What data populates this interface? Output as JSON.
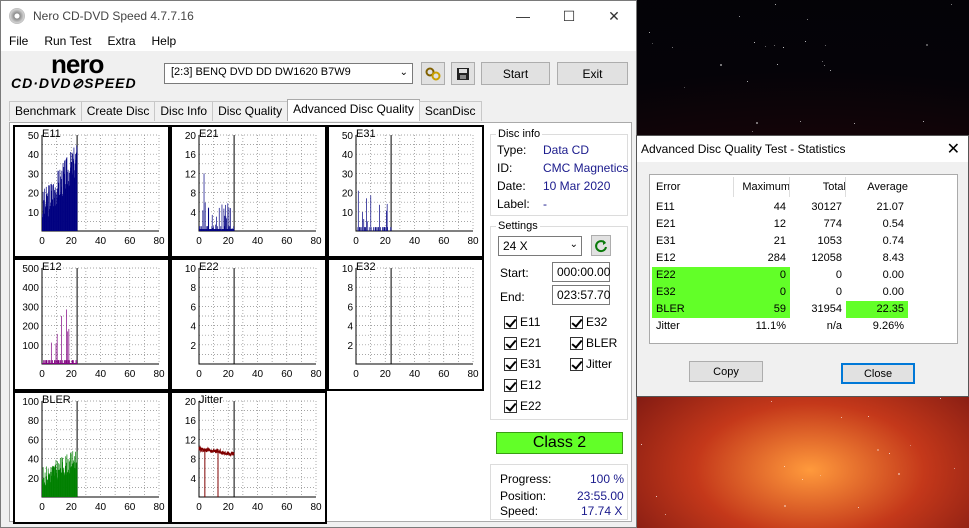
{
  "window": {
    "title": "Nero CD-DVD Speed 4.7.7.16",
    "minimize": "—",
    "maximize": "☐",
    "close": "✕"
  },
  "menu": [
    "File",
    "Run Test",
    "Extra",
    "Help"
  ],
  "logo": {
    "line1": "nero",
    "line2": "CD·DVD⊘SPEED"
  },
  "toolbar": {
    "drive": "[2:3]   BENQ DVD DD DW1620 B7W9",
    "drive_arrow": "⌄",
    "start_label": "Start",
    "exit_label": "Exit"
  },
  "tabs": [
    "Benchmark",
    "Create Disc",
    "Disc Info",
    "Disc Quality",
    "Advanced Disc Quality",
    "ScanDisc"
  ],
  "active_tab": 4,
  "charts": [
    {
      "name": "E11",
      "yticks": [
        "50",
        "40",
        "30",
        "20",
        "10"
      ],
      "xticks": [
        "0",
        "20",
        "40",
        "60",
        "80"
      ],
      "ymax": 50,
      "color": "#000080",
      "profile": "e11"
    },
    {
      "name": "E21",
      "yticks": [
        "20",
        "16",
        "12",
        "8",
        "4"
      ],
      "xticks": [
        "0",
        "20",
        "40",
        "60",
        "80"
      ],
      "ymax": 20,
      "color": "#000080",
      "profile": "e21"
    },
    {
      "name": "E31",
      "yticks": [
        "50",
        "40",
        "30",
        "20",
        "10"
      ],
      "xticks": [
        "0",
        "20",
        "40",
        "60",
        "80"
      ],
      "ymax": 50,
      "color": "#000080",
      "profile": "e31"
    },
    {
      "name": "E12",
      "yticks": [
        "500",
        "400",
        "300",
        "200",
        "100"
      ],
      "xticks": [
        "0",
        "20",
        "40",
        "60",
        "80"
      ],
      "ymax": 500,
      "color": "#800080",
      "profile": "e12"
    },
    {
      "name": "E22",
      "yticks": [
        "10",
        "8",
        "6",
        "4",
        "2"
      ],
      "xticks": [
        "0",
        "20",
        "40",
        "60",
        "80"
      ],
      "ymax": 10,
      "color": "#800080",
      "profile": "none"
    },
    {
      "name": "E32",
      "yticks": [
        "10",
        "8",
        "6",
        "4",
        "2"
      ],
      "xticks": [
        "0",
        "20",
        "40",
        "60",
        "80"
      ],
      "ymax": 10,
      "color": "#800080",
      "profile": "none"
    },
    {
      "name": "BLER",
      "yticks": [
        "100",
        "80",
        "60",
        "40",
        "20"
      ],
      "xticks": [
        "0",
        "20",
        "40",
        "60",
        "80"
      ],
      "ymax": 100,
      "color": "#008000",
      "profile": "bler"
    },
    {
      "name": "Jitter",
      "yticks": [
        "20",
        "16",
        "12",
        "8",
        "4"
      ],
      "xticks": [
        "0",
        "20",
        "40",
        "60",
        "80"
      ],
      "ymax": 20,
      "color": "#800000",
      "profile": "jitter"
    }
  ],
  "disc_info": {
    "label": "Disc info",
    "type_k": "Type:",
    "type_v": "Data CD",
    "id_k": "ID:",
    "id_v": "CMC Magnetics",
    "date_k": "Date:",
    "date_v": "10 Mar 2020",
    "label_k": "Label:",
    "label_v": "-"
  },
  "settings": {
    "label": "Settings",
    "speed": "24 X",
    "start_k": "Start:",
    "start_v": "000:00.00",
    "end_k": "End:",
    "end_v": "023:57.70",
    "checks_left": [
      "E11",
      "E21",
      "E31",
      "E12",
      "E22"
    ],
    "checks_right": [
      "E32",
      "BLER",
      "Jitter"
    ]
  },
  "class_label": "Class 2",
  "progress": {
    "progress_k": "Progress:",
    "progress_v": "100 %",
    "position_k": "Position:",
    "position_v": "23:55.00",
    "speed_k": "Speed:",
    "speed_v": "17.74 X"
  },
  "stats": {
    "title": "Advanced Disc Quality Test - Statistics",
    "headers": [
      "Error",
      "Maximum",
      "Total",
      "Average"
    ],
    "rows": [
      {
        "error": "E11",
        "max": "44",
        "total": "30127",
        "avg": "21.07"
      },
      {
        "error": "E21",
        "max": "12",
        "total": "774",
        "avg": "0.54"
      },
      {
        "error": "E31",
        "max": "21",
        "total": "1053",
        "avg": "0.74"
      },
      {
        "error": "E12",
        "max": "284",
        "total": "12058",
        "avg": "8.43"
      },
      {
        "error": "E22",
        "max": "0",
        "total": "0",
        "avg": "0.00"
      },
      {
        "error": "E32",
        "max": "0",
        "total": "0",
        "avg": "0.00"
      },
      {
        "error": "BLER",
        "max": "59",
        "total": "31954",
        "avg": "22.35"
      },
      {
        "error": "Jitter",
        "max": "11.1%",
        "total": "n/a",
        "avg": "9.26%"
      }
    ],
    "copy_label": "Copy",
    "close_label": "Close"
  },
  "colors": {
    "green": "#62ff28",
    "accent": "#000080"
  }
}
